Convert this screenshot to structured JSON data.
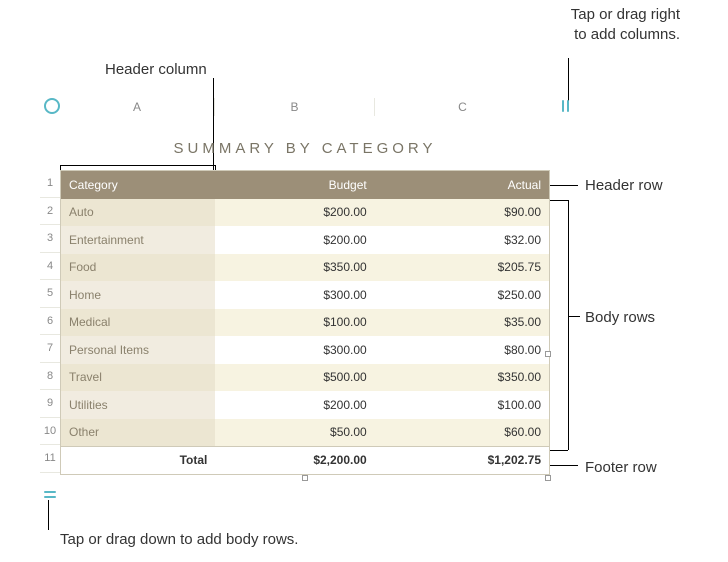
{
  "annotations": {
    "header_column": "Header column",
    "add_columns": "Tap or drag right to add columns.",
    "header_row": "Header row",
    "body_rows": "Body rows",
    "footer_row": "Footer row",
    "add_rows": "Tap or drag down to add body rows."
  },
  "table": {
    "title": "SUMMARY BY CATEGORY",
    "col_labels": [
      "A",
      "B",
      "C"
    ],
    "row_labels": [
      "1",
      "2",
      "3",
      "4",
      "5",
      "6",
      "7",
      "8",
      "9",
      "10",
      "11"
    ],
    "header": {
      "category": "Category",
      "budget": "Budget",
      "actual": "Actual"
    },
    "rows": [
      {
        "category": "Auto",
        "budget": "$200.00",
        "actual": "$90.00"
      },
      {
        "category": "Entertainment",
        "budget": "$200.00",
        "actual": "$32.00"
      },
      {
        "category": "Food",
        "budget": "$350.00",
        "actual": "$205.75"
      },
      {
        "category": "Home",
        "budget": "$300.00",
        "actual": "$250.00"
      },
      {
        "category": "Medical",
        "budget": "$100.00",
        "actual": "$35.00"
      },
      {
        "category": "Personal Items",
        "budget": "$300.00",
        "actual": "$80.00"
      },
      {
        "category": "Travel",
        "budget": "$500.00",
        "actual": "$350.00"
      },
      {
        "category": "Utilities",
        "budget": "$200.00",
        "actual": "$100.00"
      },
      {
        "category": "Other",
        "budget": "$50.00",
        "actual": "$60.00"
      }
    ],
    "footer": {
      "label": "Total",
      "budget": "$2,200.00",
      "actual": "$1,202.75"
    }
  }
}
